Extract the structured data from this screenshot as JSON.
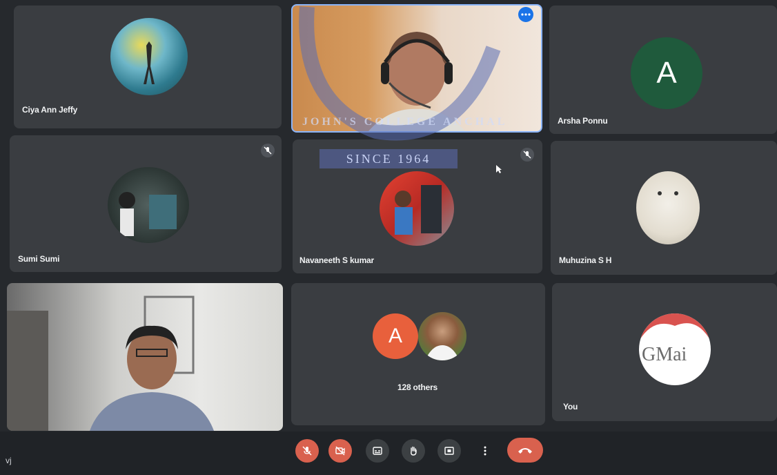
{
  "participants": [
    {
      "name": "Ciya Ann Jeffy"
    },
    {
      "name": ""
    },
    {
      "name": "Arsha Ponnu",
      "initial": "A"
    },
    {
      "name": "Sumi Sumi"
    },
    {
      "name": "Navaneeth S kumar"
    },
    {
      "name": "Muhuzina S H"
    },
    {
      "name": ""
    },
    {
      "name": "128 others",
      "initial": "A"
    },
    {
      "name": "You",
      "avatar_text": "GMai"
    }
  ],
  "watermark": {
    "text": "SINCE 1964",
    "ring_text": "JOHN'S COLLEGE ANCHAL"
  },
  "footer_label": "vj",
  "toolbar": {
    "buttons": [
      {
        "icon": "mic-off-icon"
      },
      {
        "icon": "camera-off-icon"
      },
      {
        "icon": "captions-icon"
      },
      {
        "icon": "raise-hand-icon"
      },
      {
        "icon": "present-screen-icon"
      },
      {
        "icon": "more-options-icon"
      },
      {
        "icon": "end-call-icon"
      }
    ]
  },
  "colors": {
    "tile": "#3a3d41",
    "red_button": "#d9614e",
    "accent_blue": "#1a73e8",
    "avatar_green": "#1f5a3c",
    "avatar_orange": "#e8603c"
  }
}
